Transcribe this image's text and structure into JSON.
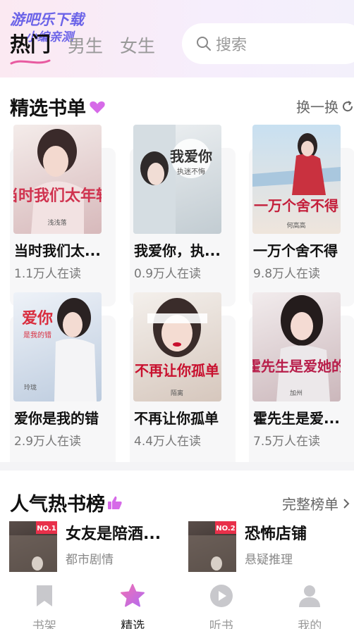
{
  "watermark": {
    "line1": "游吧乐下载",
    "line2": "小编亲测"
  },
  "tabs": [
    {
      "label": "热门",
      "active": true
    },
    {
      "label": "男生",
      "active": false
    },
    {
      "label": "女生",
      "active": false
    }
  ],
  "search": {
    "placeholder": "搜索",
    "icon": "search-icon"
  },
  "featured": {
    "title": "精选书单",
    "refresh_label": "换一换",
    "books": [
      {
        "title": "当时我们太...",
        "reads": "1.1万人在读",
        "cover_text": "当时我们太年轻",
        "cover_author": "浅浅落",
        "palette": [
          "#f1e8e6",
          "#c9a6a8"
        ],
        "accent": "#d0334f"
      },
      {
        "title": "我爱你，执...",
        "reads": "0.9万人在读",
        "cover_text": "我爱你",
        "cover_sub": "执迷不悔",
        "palette": [
          "#e7ecef",
          "#b9c4cb"
        ],
        "accent": "#333333"
      },
      {
        "title": "一万个舍不得",
        "reads": "9.8万人在读",
        "cover_text": "一万个舍不得",
        "cover_author": "何高高",
        "palette": [
          "#cfe3f2",
          "#e8d9cf"
        ],
        "accent": "#c41e3a"
      },
      {
        "title": "爱你是我的错",
        "reads": "2.9万人在读",
        "cover_text": "爱你",
        "cover_sub": "是我的错",
        "cover_author": "玲珑",
        "palette": [
          "#e8eef6",
          "#b9c8dc"
        ],
        "accent": "#d92d3e"
      },
      {
        "title": "不再让你孤单",
        "reads": "4.4万人在读",
        "cover_text": "不再让你孤单",
        "cover_author": "陌离",
        "palette": [
          "#f2eeea",
          "#d5c6bc"
        ],
        "accent": "#c8102e"
      },
      {
        "title": "霍先生是爱...",
        "reads": "7.5万人在读",
        "cover_text": "霍先生是爱她的",
        "cover_author": "加州",
        "palette": [
          "#efe9ea",
          "#cdb9bd"
        ],
        "accent": "#b81e4a"
      }
    ]
  },
  "ranking": {
    "title": "人气热书榜",
    "full_label": "完整榜单",
    "items": [
      {
        "rank": "NO.1",
        "title": "女友是陪酒...",
        "category": "都市剧情"
      },
      {
        "rank": "NO.2",
        "title": "恐怖店铺",
        "category": "悬疑推理"
      }
    ]
  },
  "nav": [
    {
      "label": "书架",
      "icon": "bookmark-icon",
      "active": false
    },
    {
      "label": "精选",
      "icon": "star-icon",
      "active": true
    },
    {
      "label": "听书",
      "icon": "play-icon",
      "active": false
    },
    {
      "label": "我的",
      "icon": "user-icon",
      "active": false
    }
  ],
  "colors": {
    "accent_pink": "#e85aa0",
    "accent_purple": "#8b5cf6",
    "rank_badge": "#e8304a"
  }
}
